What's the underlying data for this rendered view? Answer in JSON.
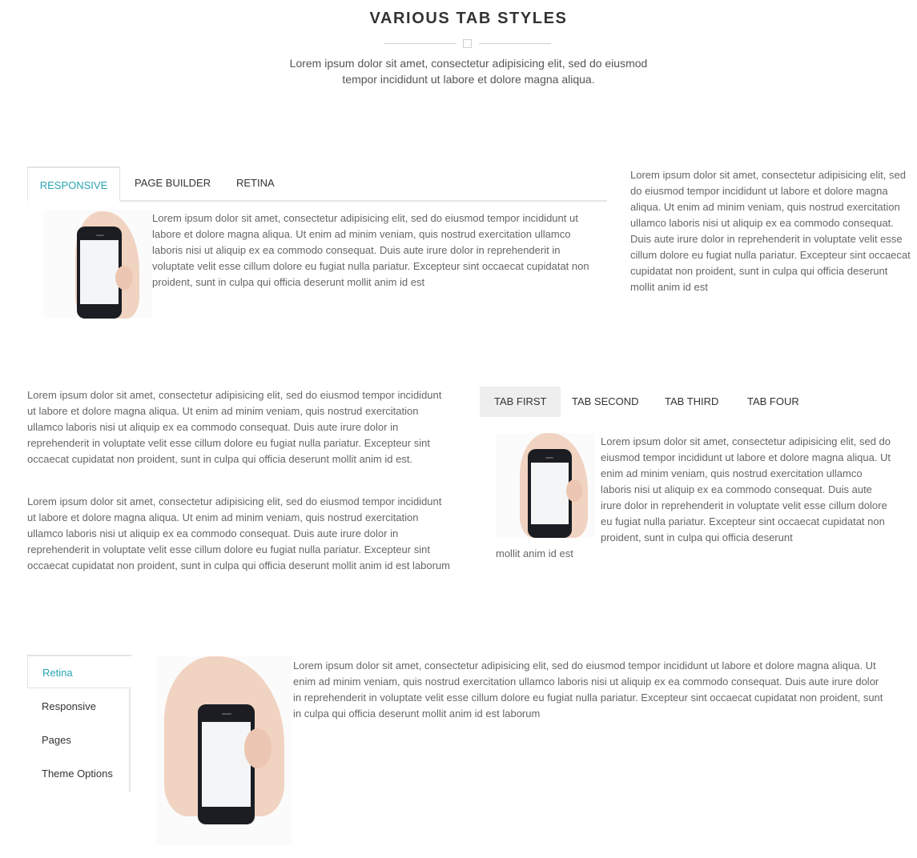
{
  "header": {
    "title": "VARIOUS TAB STYLES",
    "intro": "Lorem ipsum dolor sit amet, consectetur adipisicing elit, sed do eiusmod tempor incididunt ut labore et dolore magna aliqua."
  },
  "section1": {
    "tabs": [
      "RESPONSIVE",
      "PAGE BUILDER",
      "RETINA"
    ],
    "active_tab": "RESPONSIVE",
    "tab_content": "Lorem ipsum dolor sit amet, consectetur adipisicing elit, sed do eiusmod tempor incididunt ut labore et dolore magna aliqua. Ut enim ad minim veniam, quis nostrud exercitation ullamco laboris nisi ut aliquip ex ea commodo consequat. Duis aute irure dolor in reprehenderit in voluptate velit esse cillum dolore eu fugiat nulla pariatur. Excepteur sint occaecat cupidatat non proident, sunt in culpa qui officia deserunt mollit anim id est",
    "side_text": "Lorem ipsum dolor sit amet, consectetur adipisicing elit, sed do eiusmod tempor incididunt ut labore et dolore magna aliqua. Ut enim ad minim veniam, quis nostrud exercitation ullamco laboris nisi ut aliquip ex ea commodo consequat. Duis aute irure dolor in reprehenderit in voluptate velit esse cillum dolore eu fugiat nulla pariatur. Excepteur sint occaecat cupidatat non proident, sunt in culpa qui officia deserunt mollit anim id est"
  },
  "section2": {
    "paragraph1": "Lorem ipsum dolor sit amet, consectetur adipisicing elit, sed do eiusmod tempor incididunt ut labore et dolore magna aliqua. Ut enim ad minim veniam, quis nostrud exercitation ullamco laboris nisi ut aliquip ex ea commodo consequat. Duis aute irure dolor in reprehenderit in voluptate velit esse cillum dolore eu fugiat nulla pariatur. Excepteur sint occaecat cupidatat non proident, sunt in culpa qui officia deserunt mollit anim id est.",
    "paragraph2": "Lorem ipsum dolor sit amet, consectetur adipisicing elit, sed do eiusmod tempor incididunt ut labore et dolore magna aliqua. Ut enim ad minim veniam, quis nostrud exercitation ullamco laboris nisi ut aliquip ex ea commodo consequat. Duis aute irure dolor in reprehenderit in voluptate velit esse cillum dolore eu fugiat nulla pariatur. Excepteur sint occaecat cupidatat non proident, sunt in culpa qui officia deserunt mollit anim id est laborum",
    "tabs": [
      "TAB FIRST",
      "TAB SECOND",
      "TAB THIRD",
      "TAB FOUR"
    ],
    "active_tab": "TAB FIRST",
    "tab_content": "Lorem ipsum dolor sit amet, consectetur adipisicing elit, sed do eiusmod tempor incididunt ut labore et dolore magna aliqua. Ut enim ad minim veniam, quis nostrud exercitation ullamco laboris nisi ut aliquip ex ea commodo consequat. Duis aute irure dolor in reprehenderit in voluptate velit esse cillum dolore eu fugiat nulla pariatur. Excepteur sint occaecat cupidatat non proident, sunt in culpa qui officia deserunt",
    "tab_content_tail": "mollit anim id est"
  },
  "section3": {
    "tabs": [
      "Retina",
      "Responsive",
      "Pages",
      "Theme Options"
    ],
    "active_tab": "Retina",
    "tab_content": "Lorem ipsum dolor sit amet, consectetur adipisicing elit, sed do eiusmod tempor incididunt ut labore et dolore magna aliqua. Ut enim ad minim veniam, quis nostrud exercitation ullamco laboris nisi ut aliquip ex ea commodo consequat. Duis aute irure dolor in reprehenderit in voluptate velit esse cillum dolore eu fugiat nulla pariatur. Excepteur sint occaecat cupidatat non proident, sunt in culpa qui officia deserunt mollit anim id est laborum"
  },
  "colors": {
    "accent": "#29a6b3",
    "text": "#666666",
    "heading": "#333333",
    "active_tab_bg": "#eeeeee"
  },
  "icons": {
    "divider": "square-divider-icon",
    "image": "hand-holding-phone-image"
  }
}
